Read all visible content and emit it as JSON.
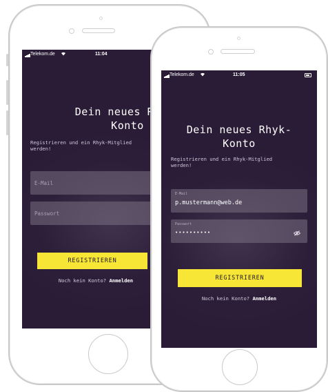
{
  "colors": {
    "screen_bg": "#2a1c37",
    "field_bg": "#78708299",
    "accent_button": "#f7e636",
    "button_text": "#1f1626",
    "frame": "#c9c9c9"
  },
  "back_phone": {
    "status": {
      "carrier": "Telekom.de",
      "time": "11:04"
    },
    "title": "Dein neues Rhyk-\nKonto",
    "subtitle": "Registrieren und ein Rhyk-Mitglied\nwerden!",
    "email": {
      "placeholder": "E-Mail"
    },
    "password": {
      "placeholder": "Passwort"
    },
    "register_label": "REGISTRIEREN",
    "footer": {
      "prompt": "Noch kein Konto?",
      "link": "Anmelden"
    }
  },
  "front_phone": {
    "status": {
      "carrier": "Telekom.de",
      "time": "11:05"
    },
    "title": "Dein neues Rhyk-\nKonto",
    "subtitle": "Registrieren und ein Rhyk-Mitglied\nwerden!",
    "email": {
      "label": "E-Mail",
      "value": "p.mustermann@web.de"
    },
    "password": {
      "label": "Passwort",
      "value": "••••••••••",
      "toggle_icon": "eye-slash-icon"
    },
    "register_label": "REGISTRIEREN",
    "footer": {
      "prompt": "Noch kein Konto?",
      "link": "Anmelden"
    }
  }
}
